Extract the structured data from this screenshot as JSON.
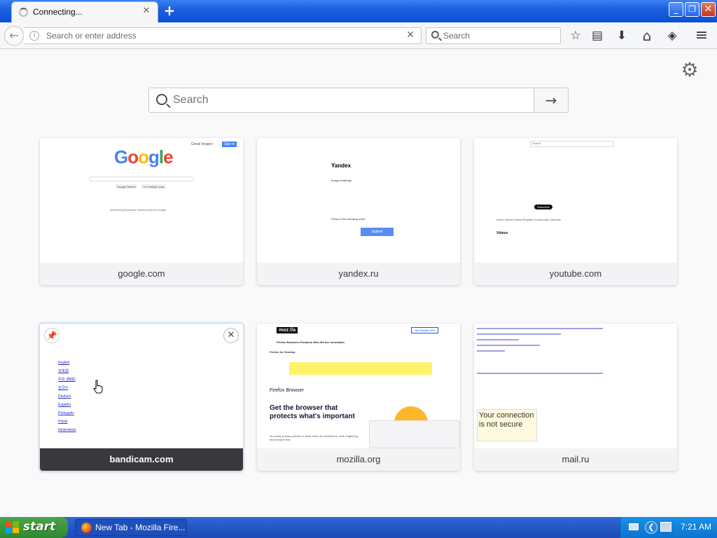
{
  "tab": {
    "title": "Connecting...",
    "close": "✕",
    "new": "+"
  },
  "window": {
    "minimize": "_",
    "maximize": "❐",
    "close": "✕"
  },
  "nav": {
    "back": "←",
    "url_placeholder": "Search or enter address",
    "url_clear": "✕",
    "search_placeholder": "Search"
  },
  "toolbar": {
    "bookmark": "☆",
    "library": "▤",
    "download": "⬇",
    "home": "⌂",
    "pocket": "◈",
    "menu": "≡"
  },
  "newtab": {
    "settings": "⚙",
    "search_placeholder": "Search",
    "search_go": "→",
    "tiles": [
      {
        "label": "google.com"
      },
      {
        "label": "yandex.ru"
      },
      {
        "label": "youtube.com"
      },
      {
        "label": "bandicam.com",
        "pin": "📌",
        "close": "✕"
      },
      {
        "label": "mozilla.org"
      },
      {
        "label": "mail.ru"
      }
    ]
  },
  "thumbs": {
    "google": {
      "logo": "Google",
      "links": "Gmail  Images",
      "signin": "Sign in",
      "btn1": "Google Search",
      "btn2": "I'm Feeling Lucky",
      "footer": "Advertising  Business Solutions  About Google"
    },
    "yandex": {
      "logo": "Yandex",
      "line1": "Image challenge",
      "line2": "Press in the following order:",
      "submit": "Submit"
    },
    "youtube": {
      "search": "Search",
      "subscribe": "Subscribe",
      "tabs": "Home   Videos   Shorts   Playlists   Community   Channels",
      "videos": "Videos"
    },
    "bandicam": {
      "links": [
        "English",
        "日本語",
        "中文 (简体)",
        "한국어",
        "Deutsch",
        "Español",
        "Português",
        "Polski",
        "Nederlands"
      ]
    },
    "mozilla": {
      "logo": "moz://a",
      "menu": "Firefox Browsers   Products   Who We Are   Innovation",
      "download": "Get Mozilla VPN",
      "sub": "Firefox for Desktop",
      "ff": "Firefox Browser",
      "headline": "Get the browser that protects what's important",
      "body": "No shady privacy policies or back doors for advertisers. Just a lightning fast browser that"
    },
    "mail": {
      "box": "Your connection is not secure"
    }
  },
  "taskbar": {
    "start": "start",
    "item": "New Tab - Mozilla Fire...",
    "clock": "7:21 AM",
    "tray_arrow": "❮"
  },
  "colors": {
    "titlebar": "#1d5fe0",
    "start": "#3a963a",
    "accent": "#0a84ff"
  }
}
